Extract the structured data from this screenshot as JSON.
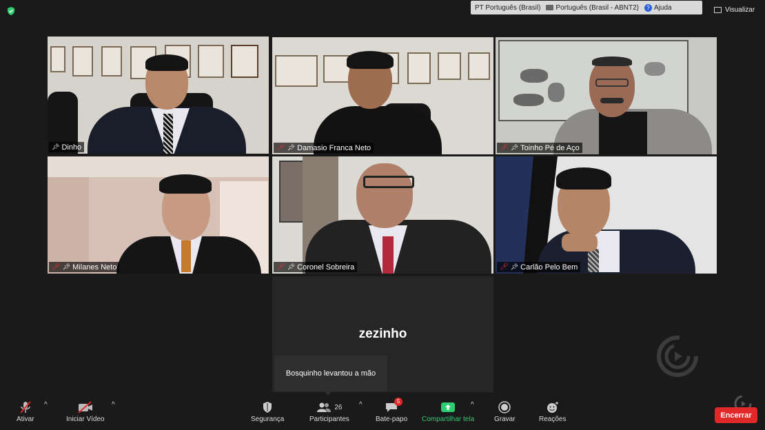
{
  "language_bar": {
    "input_language": "PT Português (Brasil)",
    "keyboard": "Português (Brasil - ABNT2)",
    "help": "Ajuda"
  },
  "view_label": "Visualizar",
  "participants_tiles": [
    {
      "name": "Dinho",
      "muted": false
    },
    {
      "name": "Damasio Franca Neto",
      "muted": true
    },
    {
      "name": "Toinho Pé de Aço",
      "muted": true
    },
    {
      "name": "Milanes Neto",
      "muted": true
    },
    {
      "name": "Coronel Sobreira",
      "muted": true
    },
    {
      "name": "Carlão Pelo Bem",
      "muted": true
    }
  ],
  "center_participant": "zezinho",
  "notification": "Bosquinho levantou a mão",
  "toolbar": {
    "audio": "Ativar",
    "video": "Iniciar Vídeo",
    "security": "Segurança",
    "participants": "Participantes",
    "participants_count": "26",
    "chat": "Bate-papo",
    "chat_badge": "5",
    "share": "Compartilhar tela",
    "record": "Gravar",
    "reactions": "Reações",
    "end": "Encerrar"
  },
  "colors": {
    "active_speaker": "#cddc39",
    "share_green": "#2ecc71",
    "end_red": "#e02828"
  }
}
